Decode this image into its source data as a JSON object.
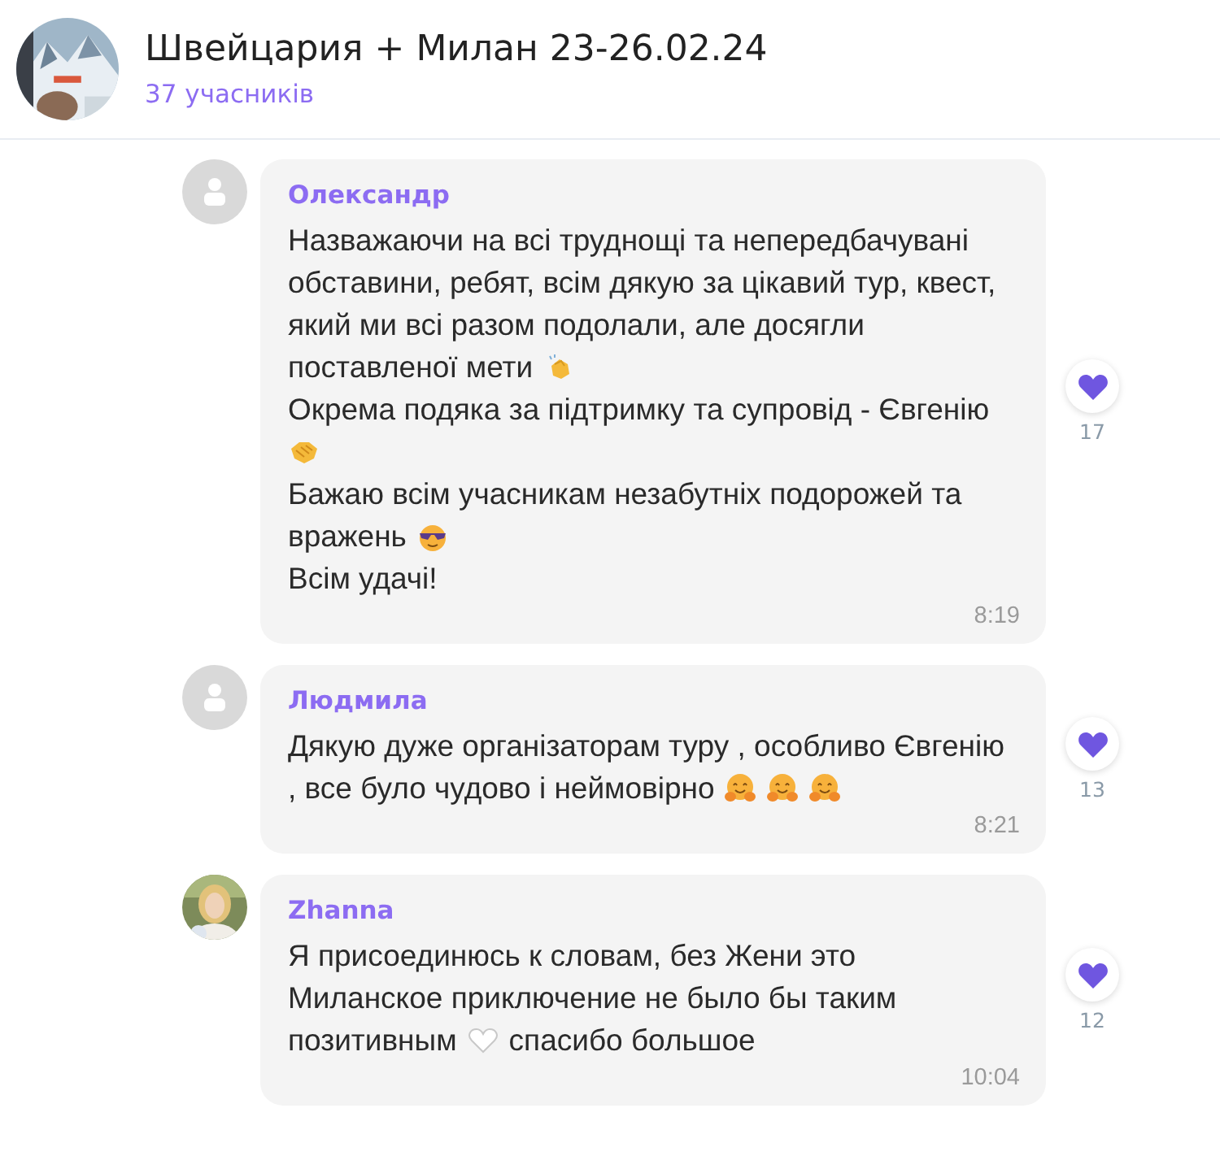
{
  "chat": {
    "title": "Швейцария + Милан 23-26.02.24",
    "members": "37 учасників"
  },
  "messages": [
    {
      "author": "Олександр",
      "lines": [
        [
          {
            "kind": "text",
            "text": "Назважаючи на всі труднощі та непередбачувані"
          }
        ],
        [
          {
            "kind": "text",
            "text": "обставини, ребят, всім дякую за цікавий тур, квест,"
          }
        ],
        [
          {
            "kind": "text",
            "text": "який ми всі разом подолали, але досягли"
          }
        ],
        [
          {
            "kind": "text",
            "text": "поставленої мети"
          },
          {
            "kind": "emoji"
          }
        ],
        [
          {
            "kind": "text",
            "text": "Окрема подяка за підтримку та супровід - Євгенію"
          }
        ],
        [
          {
            "kind": "emoji"
          }
        ],
        [
          {
            "kind": "text",
            "text": "Бажаю всім учасникам незабутніх подорожей та"
          }
        ],
        [
          {
            "kind": "text",
            "text": "вражень"
          },
          {
            "kind": "emoji"
          }
        ],
        [
          {
            "kind": "text",
            "text": "Всім удачі!"
          }
        ]
      ],
      "time": "8:19",
      "likes": "17"
    },
    {
      "author": "Людмила",
      "lines": [
        [
          {
            "kind": "text",
            "text": "Дякую дуже організаторам туру , особливо Євгенію"
          }
        ],
        [
          {
            "kind": "text",
            "text": ", все було чудово і неймовірно"
          },
          {
            "kind": "emoji"
          },
          {
            "kind": "emoji"
          },
          {
            "kind": "emoji"
          }
        ]
      ],
      "time": "8:21",
      "likes": "13"
    },
    {
      "author": "Zhanna",
      "avatar": {
        "kind": "picture"
      },
      "lines": [
        [
          {
            "kind": "text",
            "text": "Я присоединюсь к словам, без Жени это"
          }
        ],
        [
          {
            "kind": "text",
            "text": "Миланское приключение не было бы таким"
          }
        ],
        [
          {
            "kind": "text",
            "text": "позитивным"
          },
          {
            "kind": "emoji"
          },
          {
            "kind": "text",
            "text": "спасибо большое"
          }
        ]
      ],
      "time": "10:04",
      "likes": "12"
    }
  ]
}
